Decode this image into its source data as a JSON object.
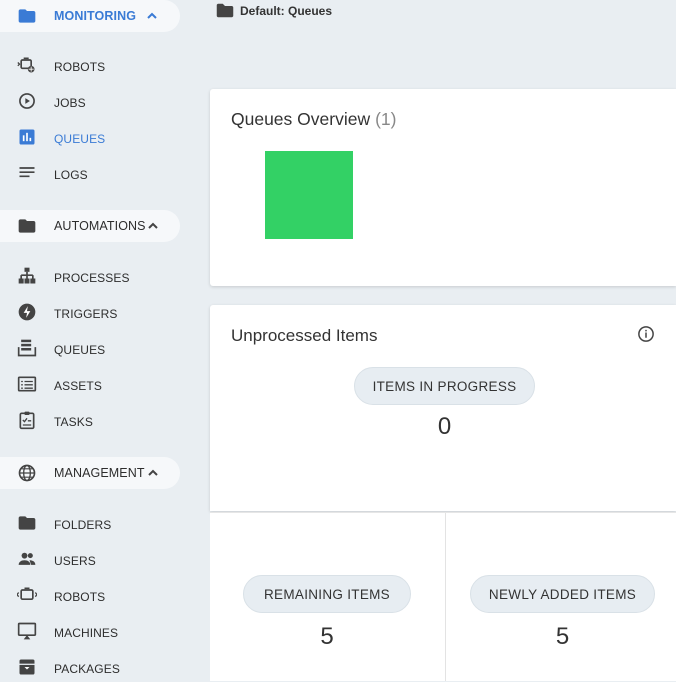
{
  "sidebar": {
    "monitoring": {
      "label": "MONITORING",
      "items": [
        {
          "label": "ROBOTS",
          "icon": "robot-icon"
        },
        {
          "label": "JOBS",
          "icon": "play-circle-icon"
        },
        {
          "label": "QUEUES",
          "icon": "bar-chart-icon",
          "active": true
        },
        {
          "label": "LOGS",
          "icon": "lines-icon"
        }
      ]
    },
    "automations": {
      "label": "AUTOMATIONS",
      "items": [
        {
          "label": "PROCESSES",
          "icon": "hierarchy-icon"
        },
        {
          "label": "TRIGGERS",
          "icon": "bolt-icon"
        },
        {
          "label": "QUEUES",
          "icon": "queue-stack-icon"
        },
        {
          "label": "ASSETS",
          "icon": "list-card-icon"
        },
        {
          "label": "TASKS",
          "icon": "clipboard-check-icon"
        }
      ]
    },
    "management": {
      "label": "MANAGEMENT",
      "items": [
        {
          "label": "FOLDERS",
          "icon": "folder-icon"
        },
        {
          "label": "USERS",
          "icon": "users-icon"
        },
        {
          "label": "ROBOTS",
          "icon": "robot-icon"
        },
        {
          "label": "MACHINES",
          "icon": "monitor-icon"
        },
        {
          "label": "PACKAGES",
          "icon": "archive-icon"
        }
      ]
    }
  },
  "breadcrumb": {
    "text": "Default: Queues"
  },
  "overview": {
    "title": "Queues Overview",
    "count": "(1)",
    "swatch_color": "#33d165"
  },
  "unprocessed": {
    "title": "Unprocessed Items",
    "in_progress": {
      "label": "ITEMS IN PROGRESS",
      "value": "0"
    },
    "remaining": {
      "label": "REMAINING ITEMS",
      "value": "5"
    },
    "newly_added": {
      "label": "NEWLY ADDED ITEMS",
      "value": "5"
    }
  },
  "colors": {
    "accent": "#3a7bd5",
    "icon": "#444444",
    "background": "#e9eef2"
  }
}
